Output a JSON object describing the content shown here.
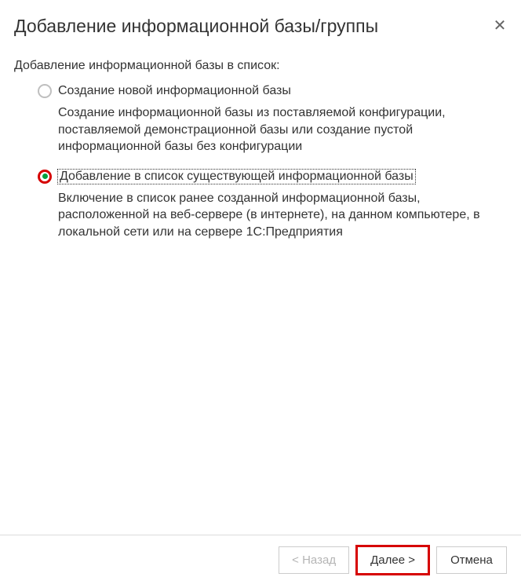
{
  "dialog": {
    "title": "Добавление информационной базы/группы",
    "prompt": "Добавление информационной базы в список:"
  },
  "options": {
    "create": {
      "label": "Создание новой информационной базы",
      "desc": "Создание информационной базы из поставляемой конфигурации, поставляемой демонстрационной базы или создание пустой информационной базы без конфигурации"
    },
    "existing": {
      "label": "Добавление в список существующей информационной базы",
      "desc": "Включение в список ранее созданной информационной базы, расположенной на веб-сервере (в интернете), на данном компьютере,  в локальной сети или на сервере 1С:Предприятия"
    }
  },
  "footer": {
    "back": "< Назад",
    "next": "Далее >",
    "cancel": "Отмена"
  }
}
